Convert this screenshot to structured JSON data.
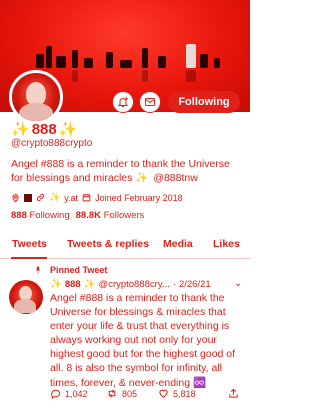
{
  "colors": {
    "accent": "#e0201a",
    "banner": "#e8160c"
  },
  "profile": {
    "name": "888",
    "handle": "@crypto888crypto",
    "bio": "Angel #888 is a reminder to thank the Universe for blessings and miracles ✨",
    "bio_mention": "@888tnw",
    "link": "y.at",
    "joined": "Joined February 2018",
    "following_count": "888",
    "following_label": "Following",
    "followers_count": "88.8K",
    "followers_label": "Followers",
    "follow_button": "Following",
    "icons": [
      "bell-plus-icon",
      "mail-icon",
      "location-icon",
      "link-icon",
      "calendar-icon"
    ]
  },
  "tabs": [
    "Tweets",
    "Tweets & replies",
    "Media",
    "Likes"
  ],
  "tweet": {
    "pinned_label": "Pinned Tweet",
    "name": "888",
    "handle": "@crypto888cry...",
    "date": "2/26/21",
    "text": "Angel #888 is a reminder to thank the Universe for blessings & miracles that enter your life & trust that everything is always working out not only for your highest good but for the highest good of all. 8 is also the symbol for infinity, all times, forever, & never-ending ♾️",
    "replies": "1,042",
    "retweets": "805",
    "likes": "5,818"
  }
}
